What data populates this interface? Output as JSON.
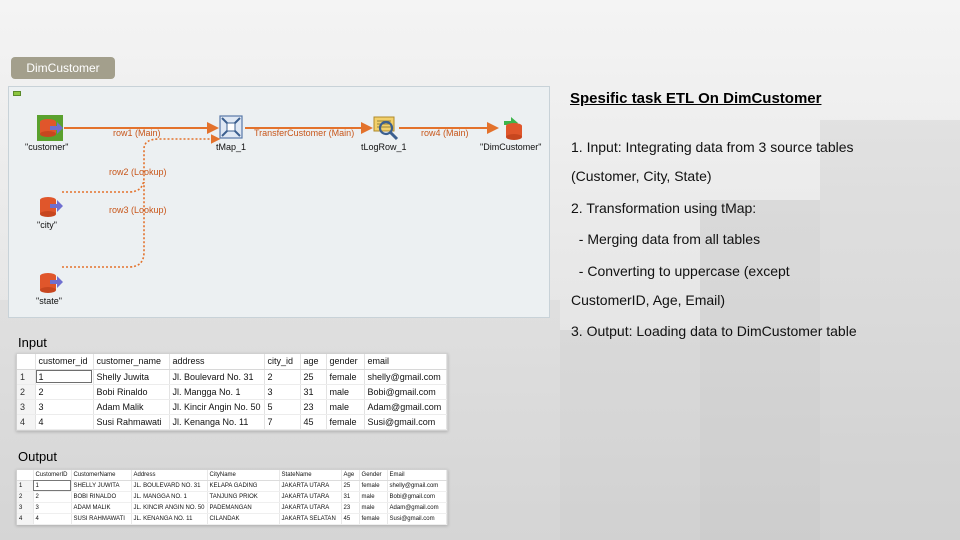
{
  "tag": "DimCustomer",
  "etl": {
    "nodes": {
      "customer": "\"customer\"",
      "city": "\"city\"",
      "state": "\"state\"",
      "tmap": "tMap_1",
      "tlogrow": "tLogRow_1",
      "dim": "\"DimCustomer\""
    },
    "links": {
      "row1": "row1 (Main)",
      "transfer": "TransferCustomer (Main)",
      "row4": "row4 (Main)",
      "row2": "row2 (Lookup)",
      "row3": "row3 (Lookup)"
    },
    "colors": {
      "main_link": "#e3722c",
      "lookup_link": "#e3722c",
      "db_icon": "#e0562b",
      "arrow_icon": "#6f6fd0"
    }
  },
  "panel": {
    "title": "Spesific task ETL On DimCustomer",
    "lines": [
      "1. Input: Integrating data from 3 source tables",
      "(Customer, City, State)",
      "2. Transformation using tMap:",
      "  - Merging data from all tables",
      "  - Converting to uppercase (except",
      "CustomerID, Age, Email)",
      "3. Output: Loading data to DimCustomer table"
    ]
  },
  "input": {
    "label": "Input",
    "columns": [
      "",
      "customer_id",
      "customer_name",
      "address",
      "city_id",
      "age",
      "gender",
      "email"
    ],
    "rows": [
      [
        "1",
        "1",
        "Shelly Juwita",
        "Jl. Boulevard No. 31",
        "2",
        "25",
        "female",
        "shelly@gmail.com"
      ],
      [
        "2",
        "2",
        "Bobi Rinaldo",
        "Jl. Mangga No. 1",
        "3",
        "31",
        "male",
        "Bobi@gmail.com"
      ],
      [
        "3",
        "3",
        "Adam Malik",
        "Jl. Kincir Angin No. 50",
        "5",
        "23",
        "male",
        "Adam@gmail.com"
      ],
      [
        "4",
        "4",
        "Susi Rahmawati",
        "Jl. Kenanga No. 11",
        "7",
        "45",
        "female",
        "Susi@gmail.com"
      ]
    ]
  },
  "output": {
    "label": "Output",
    "columns": [
      "",
      "CustomerID",
      "CustomerName",
      "Address",
      "CityName",
      "StateName",
      "Age",
      "Gender",
      "Email"
    ],
    "rows": [
      [
        "1",
        "1",
        "SHELLY JUWITA",
        "JL. BOULEVARD NO. 31",
        "KELAPA GADING",
        "JAKARTA UTARA",
        "25",
        "female",
        "shelly@gmail.com"
      ],
      [
        "2",
        "2",
        "BOBI RINALDO",
        "JL. MANGGA NO. 1",
        "TANJUNG PRIOK",
        "JAKARTA UTARA",
        "31",
        "male",
        "Bobi@gmail.com"
      ],
      [
        "3",
        "3",
        "ADAM MALIK",
        "JL. KINCIR ANGIN NO. 50",
        "PADEMANGAN",
        "JAKARTA UTARA",
        "23",
        "male",
        "Adam@gmail.com"
      ],
      [
        "4",
        "4",
        "SUSI RAHMAWATI",
        "JL. KENANGA NO. 11",
        "CILANDAK",
        "JAKARTA SELATAN",
        "45",
        "female",
        "Susi@gmail.com"
      ]
    ]
  }
}
